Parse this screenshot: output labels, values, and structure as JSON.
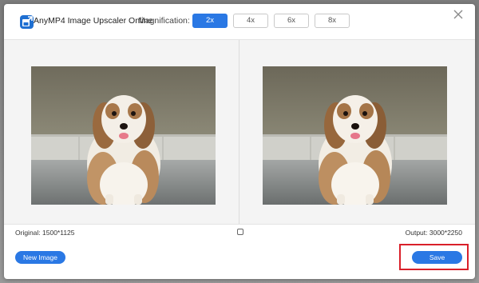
{
  "header": {
    "app_title": "AnyMP4 Image Upscaler Online",
    "magnification_label": "Magnification:",
    "magnification_options": [
      "2x",
      "4x",
      "6x",
      "8x"
    ],
    "selected_magnification": "2x"
  },
  "info": {
    "original": "Original: 1500*1125",
    "output": "Output: 3000*2250"
  },
  "actions": {
    "new_image_label": "New Image",
    "save_label": "Save"
  },
  "colors": {
    "accent": "#2a78e4",
    "highlight": "#d9202a"
  },
  "icons": {
    "logo": "app-logo-icon",
    "close": "close-icon",
    "compare": "compare-toggle-icon"
  }
}
